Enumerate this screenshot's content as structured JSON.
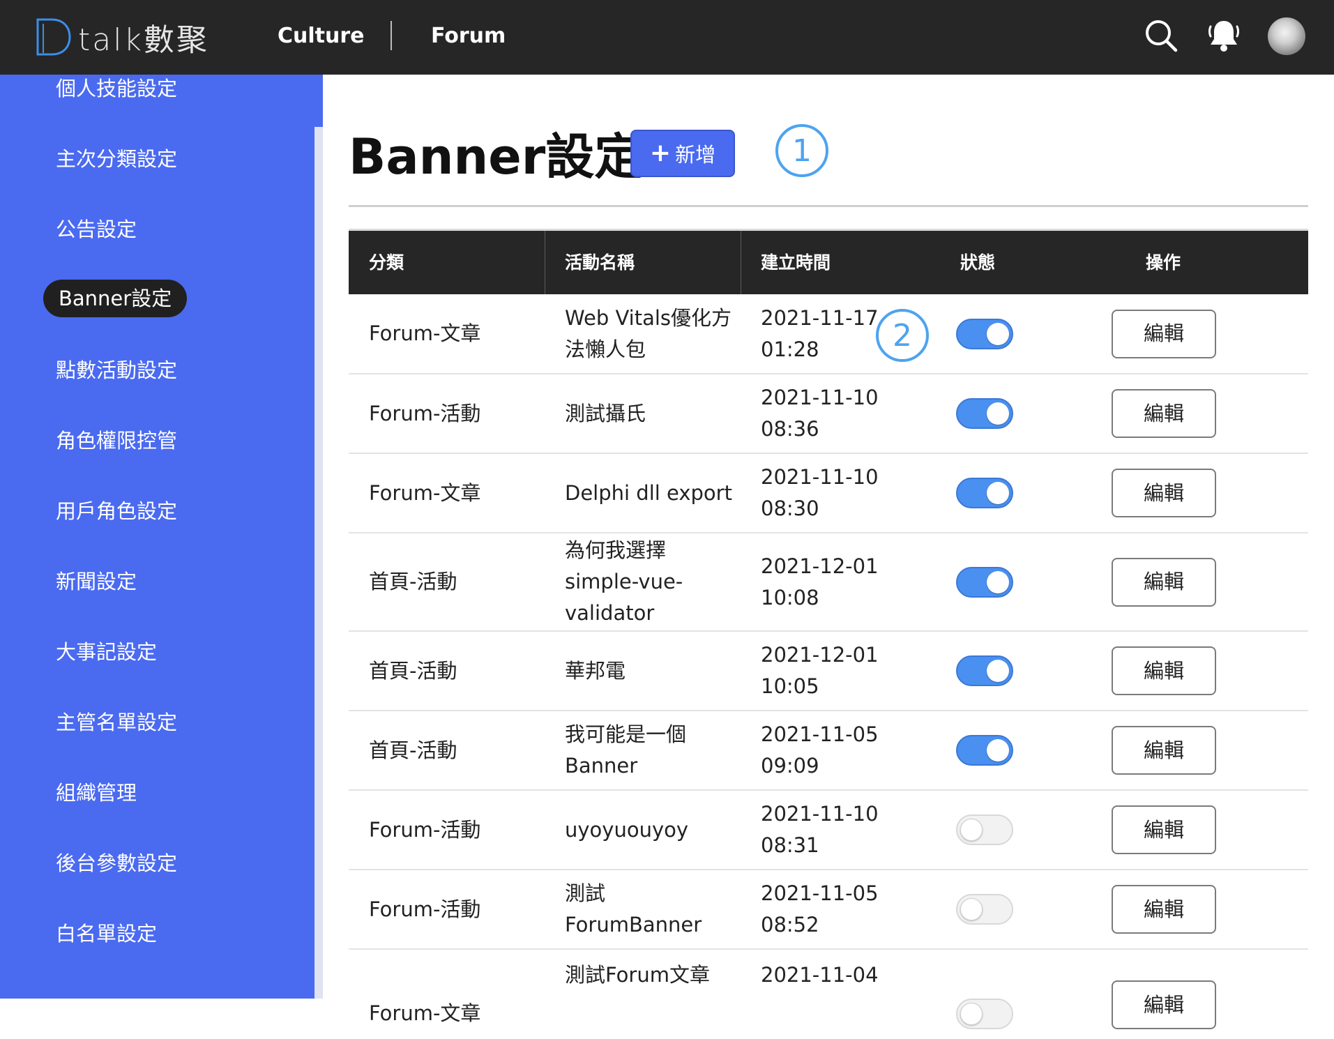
{
  "header": {
    "logo_text": "talk數聚",
    "nav": [
      "Culture",
      "Forum"
    ]
  },
  "sidebar": {
    "items": [
      {
        "label": "個人技能設定",
        "active": false
      },
      {
        "label": "主次分類設定",
        "active": false
      },
      {
        "label": "公告設定",
        "active": false
      },
      {
        "label": "Banner設定",
        "active": true
      },
      {
        "label": "點數活動設定",
        "active": false
      },
      {
        "label": "角色權限控管",
        "active": false
      },
      {
        "label": "用戶角色設定",
        "active": false
      },
      {
        "label": "新聞設定",
        "active": false
      },
      {
        "label": "大事記設定",
        "active": false
      },
      {
        "label": "主管名單設定",
        "active": false
      },
      {
        "label": "組織管理",
        "active": false
      },
      {
        "label": "後台參數設定",
        "active": false
      },
      {
        "label": "白名單設定",
        "active": false
      }
    ]
  },
  "page": {
    "title": "Banner設定",
    "add_label": "新增",
    "markers": [
      "1",
      "2"
    ]
  },
  "table": {
    "headers": [
      "分類",
      "活動名稱",
      "建立時間",
      "狀態",
      "操作"
    ],
    "edit_label": "編輯",
    "rows": [
      {
        "category": "Forum-文章",
        "name": "Web Vitals優化方法懶人包",
        "date": "2021-11-17",
        "time": "01:28",
        "enabled": true
      },
      {
        "category": "Forum-活動",
        "name": "測試攝氏",
        "date": "2021-11-10",
        "time": "08:36",
        "enabled": true
      },
      {
        "category": "Forum-文章",
        "name": "Delphi dll export",
        "date": "2021-11-10",
        "time": "08:30",
        "enabled": true
      },
      {
        "category": "首頁-活動",
        "name": "為何我選擇 simple-vue-validator",
        "date": "2021-12-01",
        "time": "10:08",
        "enabled": true
      },
      {
        "category": "首頁-活動",
        "name": "華邦電",
        "date": "2021-12-01",
        "time": "10:05",
        "enabled": true
      },
      {
        "category": "首頁-活動",
        "name": "我可能是一個 Banner",
        "date": "2021-11-05",
        "time": "09:09",
        "enabled": true
      },
      {
        "category": "Forum-活動",
        "name": "uyoyuouyoy",
        "date": "2021-11-10",
        "time": "08:31",
        "enabled": false
      },
      {
        "category": "Forum-活動",
        "name": "測試 ForumBanner",
        "date": "2021-11-05",
        "time": "08:52",
        "enabled": false
      },
      {
        "category": "Forum-文章",
        "name": "測試Forum文章",
        "date": "2021-11-04",
        "time": "",
        "enabled": false
      }
    ]
  },
  "colors": {
    "topbar": "#262626",
    "sidebar": "#4a6af0",
    "toggle_on": "#4a90f0",
    "marker": "#4ea3ef"
  }
}
